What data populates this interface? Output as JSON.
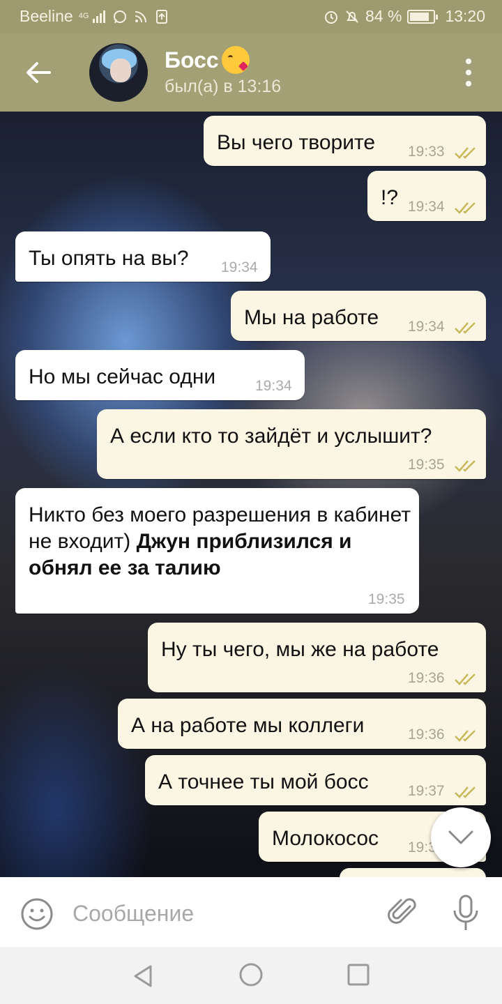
{
  "status_bar": {
    "carrier": "Beeline",
    "network": "4G",
    "battery_percent_label": "84 %",
    "battery_level": 0.84,
    "time": "13:20"
  },
  "header": {
    "contact_name": "Босс",
    "name_emoji": "face-blowing-kiss-icon",
    "status": "был(а) в 13:16"
  },
  "messages": [
    {
      "direction": "out",
      "text": "Вы чего творите",
      "time": "19:33",
      "read": true
    },
    {
      "direction": "out",
      "text": "!?",
      "time": "19:34",
      "read": true
    },
    {
      "direction": "in",
      "text": "Ты опять на вы?",
      "time": "19:34"
    },
    {
      "direction": "out",
      "text": "Мы на работе",
      "time": "19:34",
      "read": true
    },
    {
      "direction": "in",
      "text": "Но мы сейчас одни",
      "time": "19:34"
    },
    {
      "direction": "out",
      "text": "А если кто то зайдёт и услышит?",
      "time": "19:35",
      "read": true
    },
    {
      "direction": "in",
      "text_plain": "Никто без моего разрешения в кабинет не входит)",
      "text_bold": "Джун приблизился и обнял ее за талию",
      "time": "19:35"
    },
    {
      "direction": "out",
      "text": "Ну ты чего, мы же на работе",
      "time": "19:36",
      "read": true
    },
    {
      "direction": "out",
      "text": "А на работе мы коллеги",
      "time": "19:36",
      "read": true
    },
    {
      "direction": "out",
      "text": "А точнее ты мой босс",
      "time": "19:37",
      "read": true
    },
    {
      "direction": "out",
      "text": "Молокосос",
      "time": "19:3",
      "read": true
    }
  ],
  "composer": {
    "placeholder": "Сообщение"
  },
  "colors": {
    "header": "#a3a075",
    "status_bar": "#9e9a70",
    "outgoing_bubble": "#fbf6e4",
    "incoming_bubble": "#ffffff",
    "read_check": "#c9b85a"
  }
}
